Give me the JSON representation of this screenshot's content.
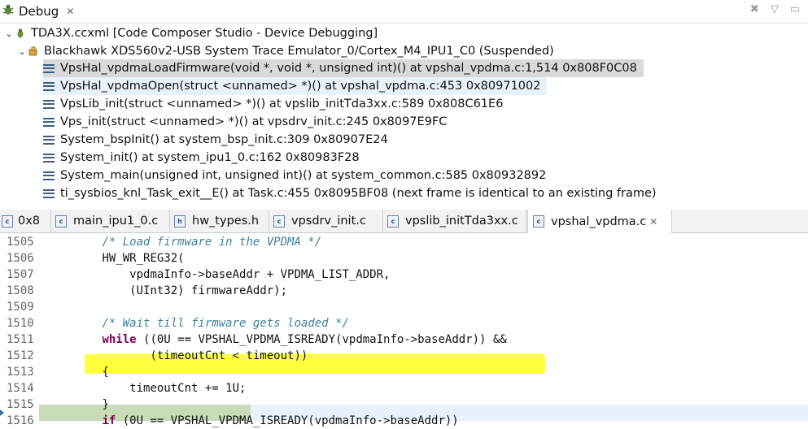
{
  "debug_view": {
    "tab_label": "Debug",
    "tree": {
      "session": "TDA3X.ccxml [Code Composer Studio - Device Debugging]",
      "target": "Blackhawk XDS560v2-USB System Trace Emulator_0/Cortex_M4_IPU1_C0 (Suspended)",
      "frames": [
        "VpsHal_vpdmaLoadFirmware(void *, void *, unsigned int)() at vpshal_vpdma.c:1,514 0x808F0C08",
        "VpsHal_vpdmaOpen(struct <unnamed> *)() at vpshal_vpdma.c:453 0x80971002",
        "VpsLib_init(struct <unnamed> *)() at vpslib_initTda3xx.c:589 0x808C61E6",
        "Vps_init(struct <unnamed> *)() at vpsdrv_init.c:245 0x8097E9FC",
        "System_bspInit() at system_bsp_init.c:309 0x80907E24",
        "System_init() at system_ipu1_0.c:162 0x80983F28",
        "System_main(unsigned int, unsigned int)() at system_common.c:585 0x80932892",
        "ti_sysbios_knl_Task_exit__E() at Task.c:455 0x8095BF08  (next frame is identical to an existing frame)"
      ]
    }
  },
  "editor": {
    "tabs": [
      "0x8",
      "main_ipu1_0.c",
      "hw_types.h",
      "vpsdrv_init.c",
      "vpslib_initTda3xx.c",
      "vpshal_vpdma.c"
    ],
    "lines": [
      {
        "no": "1505",
        "indent": "        ",
        "parts": [
          {
            "t": "/* Load firmware in the VPDMA */",
            "c": "comment"
          }
        ]
      },
      {
        "no": "1506",
        "indent": "        ",
        "parts": [
          {
            "t": "HW_WR_REG32(",
            "c": ""
          }
        ]
      },
      {
        "no": "1507",
        "indent": "            ",
        "parts": [
          {
            "t": "vpdmaInfo->baseAddr + VPDMA_LIST_ADDR,",
            "c": ""
          }
        ]
      },
      {
        "no": "1508",
        "indent": "            ",
        "parts": [
          {
            "t": "(UInt32) firmwareAddr);",
            "c": ""
          }
        ]
      },
      {
        "no": "1509",
        "indent": "",
        "parts": []
      },
      {
        "no": "1510",
        "indent": "        ",
        "parts": [
          {
            "t": "/* Wait till firmware gets loaded */",
            "c": "comment"
          }
        ]
      },
      {
        "no": "1511",
        "indent": "        ",
        "parts": [
          {
            "t": "while",
            "c": "kw"
          },
          {
            "t": " ((0U == VPSHAL_VPDMA_ISREADY(vpdmaInfo->baseAddr)) &&",
            "c": ""
          }
        ]
      },
      {
        "no": "1512",
        "indent": "               ",
        "parts": [
          {
            "t": "(timeoutCnt < timeout))",
            "c": ""
          }
        ]
      },
      {
        "no": "1513",
        "indent": "        ",
        "parts": [
          {
            "t": "{",
            "c": ""
          }
        ]
      },
      {
        "no": "1514",
        "indent": "            ",
        "parts": [
          {
            "t": "timeoutCnt += 1U;",
            "c": ""
          }
        ]
      },
      {
        "no": "1515",
        "indent": "        ",
        "parts": [
          {
            "t": "}",
            "c": ""
          }
        ]
      },
      {
        "no": "1516",
        "indent": "        ",
        "parts": [
          {
            "t": "if",
            "c": "kw"
          },
          {
            "t": " (0U == VPSHAL_VPDMA_ISREADY(vpdmaInfo->baseAddr))",
            "c": ""
          }
        ]
      }
    ]
  },
  "colors": {
    "highlight": "#ffff40",
    "current_line": "#c8dcb8",
    "comment": "#3f7f9f",
    "keyword": "#7f0055"
  }
}
